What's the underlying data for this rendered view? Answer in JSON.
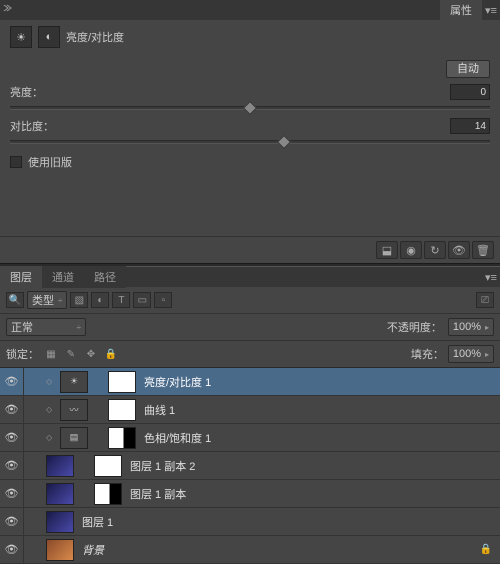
{
  "properties": {
    "tab_label": "属性",
    "adj_name": "亮度/对比度",
    "auto_label": "自动",
    "brightness_label": "亮度：",
    "brightness_value": "0",
    "contrast_label": "对比度：",
    "contrast_value": "14",
    "legacy_label": "使用旧版"
  },
  "layers_panel": {
    "tabs": [
      "图层",
      "通道",
      "路径"
    ],
    "kind_label": "类型",
    "blend_mode": "正常",
    "opacity_label": "不透明度：",
    "opacity_value": "100%",
    "lock_label": "锁定：",
    "fill_label": "填充：",
    "fill_value": "100%"
  },
  "layers": [
    {
      "name": "亮度/对比度 1"
    },
    {
      "name": "曲线 1"
    },
    {
      "name": "色相/饱和度 1"
    },
    {
      "name": "图层 1 副本 2"
    },
    {
      "name": "图层 1 副本"
    },
    {
      "name": "图层 1"
    },
    {
      "name": "背景"
    }
  ]
}
